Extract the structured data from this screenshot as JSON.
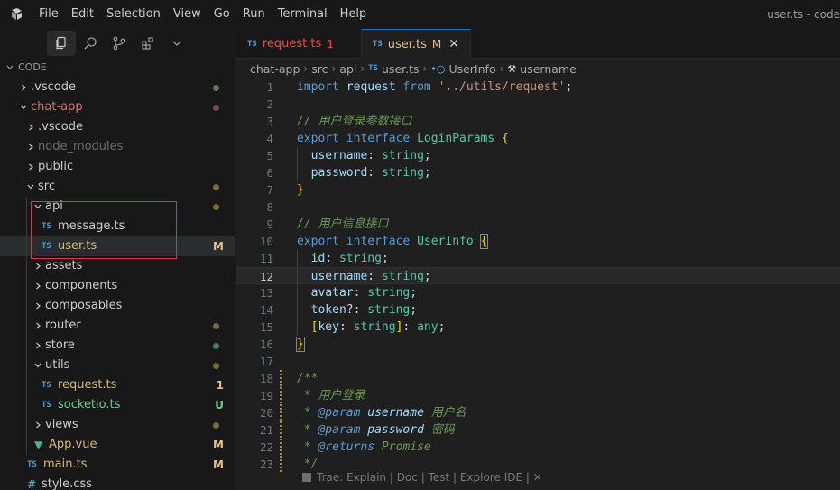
{
  "titlebar": {
    "menu": [
      "File",
      "Edit",
      "Selection",
      "View",
      "Go",
      "Run",
      "Terminal",
      "Help"
    ],
    "window_title": "user.ts - code"
  },
  "sidebar": {
    "toolbar_icons": [
      "explorer-icon",
      "search-icon",
      "source-control-icon",
      "extensions-icon",
      "chevron-down-icon"
    ],
    "section_title": "CODE",
    "tree": [
      {
        "label": ".vscode",
        "depth": 0,
        "kind": "folder",
        "open": false,
        "dot": "#5a7a6a"
      },
      {
        "label": "chat-app",
        "depth": 0,
        "kind": "folder",
        "open": true,
        "color": "red",
        "dot": "#7a4a4a"
      },
      {
        "label": ".vscode",
        "depth": 1,
        "kind": "folder",
        "open": false
      },
      {
        "label": "node_modules",
        "depth": 1,
        "kind": "folder",
        "open": false,
        "color": "dim"
      },
      {
        "label": "public",
        "depth": 1,
        "kind": "folder",
        "open": false
      },
      {
        "label": "src",
        "depth": 1,
        "kind": "folder",
        "open": true,
        "dot": "#7a6a3a"
      },
      {
        "label": "api",
        "depth": 2,
        "kind": "folder",
        "open": true,
        "dot": "#7a6a3a"
      },
      {
        "label": "message.ts",
        "depth": 3,
        "kind": "ts"
      },
      {
        "label": "user.ts",
        "depth": 3,
        "kind": "ts",
        "badge": "M",
        "selected": true
      },
      {
        "label": "assets",
        "depth": 2,
        "kind": "folder",
        "open": false
      },
      {
        "label": "components",
        "depth": 2,
        "kind": "folder",
        "open": false
      },
      {
        "label": "composables",
        "depth": 2,
        "kind": "folder",
        "open": false
      },
      {
        "label": "router",
        "depth": 2,
        "kind": "folder",
        "open": false,
        "dot": "#7a6a3a"
      },
      {
        "label": "store",
        "depth": 2,
        "kind": "folder",
        "open": false,
        "dot": "#4a7a6a"
      },
      {
        "label": "utils",
        "depth": 2,
        "kind": "folder",
        "open": true,
        "dot": "#7a6a3a"
      },
      {
        "label": "request.ts",
        "depth": 3,
        "kind": "ts",
        "badge": "1"
      },
      {
        "label": "socketio.ts",
        "depth": 3,
        "kind": "ts",
        "badge": "U"
      },
      {
        "label": "views",
        "depth": 2,
        "kind": "folder",
        "open": false,
        "dot": "#7a6a3a"
      },
      {
        "label": "App.vue",
        "depth": 2,
        "kind": "vue",
        "badge": "M"
      },
      {
        "label": "main.ts",
        "depth": 1,
        "kind": "ts",
        "badge": "M"
      },
      {
        "label": "style.css",
        "depth": 1,
        "kind": "css"
      }
    ]
  },
  "tabs": [
    {
      "label": "request.ts",
      "status": "1",
      "kind": "err",
      "active": false
    },
    {
      "label": "user.ts",
      "status": "M",
      "kind": "mod",
      "active": true
    }
  ],
  "breadcrumb": [
    "chat-app",
    "src",
    "api",
    "user.ts",
    "UserInfo",
    "username"
  ],
  "code": {
    "current_line": 12,
    "lines": [
      [
        [
          "k",
          "import"
        ],
        [
          "p",
          " "
        ],
        [
          "v",
          "request"
        ],
        [
          "p",
          " "
        ],
        [
          "k",
          "from"
        ],
        [
          "p",
          " "
        ],
        [
          "s",
          "'../utils/request'"
        ],
        [
          "p",
          ";"
        ]
      ],
      [],
      [
        [
          "c",
          "// 用户登录参数接口"
        ]
      ],
      [
        [
          "k",
          "export"
        ],
        [
          "p",
          " "
        ],
        [
          "k",
          "interface"
        ],
        [
          "p",
          " "
        ],
        [
          "t",
          "LoginParams"
        ],
        [
          "p",
          " "
        ],
        [
          "br",
          "{"
        ]
      ],
      [
        [
          "p",
          "  "
        ],
        [
          "v",
          "username"
        ],
        [
          "p",
          ": "
        ],
        [
          "t",
          "string"
        ],
        [
          "p",
          ";"
        ]
      ],
      [
        [
          "p",
          "  "
        ],
        [
          "v",
          "password"
        ],
        [
          "p",
          ": "
        ],
        [
          "t",
          "string"
        ],
        [
          "p",
          ";"
        ]
      ],
      [
        [
          "br",
          "}"
        ]
      ],
      [],
      [
        [
          "c",
          "// 用户信息接口"
        ]
      ],
      [
        [
          "k",
          "export"
        ],
        [
          "p",
          " "
        ],
        [
          "k",
          "interface"
        ],
        [
          "p",
          " "
        ],
        [
          "t",
          "UserInfo"
        ],
        [
          "p",
          " "
        ],
        [
          "brh",
          "{"
        ]
      ],
      [
        [
          "p",
          "  "
        ],
        [
          "v",
          "id"
        ],
        [
          "p",
          ": "
        ],
        [
          "t",
          "string"
        ],
        [
          "p",
          ";"
        ]
      ],
      [
        [
          "p",
          "  "
        ],
        [
          "v",
          "username"
        ],
        [
          "p",
          ": "
        ],
        [
          "t",
          "string"
        ],
        [
          "p",
          ";"
        ]
      ],
      [
        [
          "p",
          "  "
        ],
        [
          "v",
          "avatar"
        ],
        [
          "p",
          ": "
        ],
        [
          "t",
          "string"
        ],
        [
          "p",
          ";"
        ]
      ],
      [
        [
          "p",
          "  "
        ],
        [
          "v",
          "token"
        ],
        [
          "p",
          "?: "
        ],
        [
          "t",
          "string"
        ],
        [
          "p",
          ";"
        ]
      ],
      [
        [
          "p",
          "  "
        ],
        [
          "br",
          "["
        ],
        [
          "v",
          "key"
        ],
        [
          "p",
          ": "
        ],
        [
          "t",
          "string"
        ],
        [
          "br",
          "]"
        ],
        [
          "p",
          ": "
        ],
        [
          "t",
          "any"
        ],
        [
          "p",
          ";"
        ]
      ],
      [
        [
          "brh",
          "}"
        ]
      ],
      [],
      [
        [
          "ci",
          "/**"
        ]
      ],
      [
        [
          "ci",
          " * 用户登录"
        ]
      ],
      [
        [
          "ci",
          " * "
        ],
        [
          "jd",
          "@param"
        ],
        [
          "p",
          " "
        ],
        [
          "jp",
          "username"
        ],
        [
          "ci",
          " 用户名"
        ]
      ],
      [
        [
          "ci",
          " * "
        ],
        [
          "jd",
          "@param"
        ],
        [
          "p",
          " "
        ],
        [
          "jp",
          "password"
        ],
        [
          "ci",
          " 密码"
        ]
      ],
      [
        [
          "ci",
          " * "
        ],
        [
          "jd",
          "@returns"
        ],
        [
          "ci",
          " Promise"
        ]
      ],
      [
        [
          "ci",
          " */"
        ]
      ]
    ],
    "gitbar_lines": [
      18,
      19,
      20,
      21,
      22,
      23
    ],
    "guide_lines": [
      5,
      6,
      11,
      12,
      13,
      14,
      15
    ]
  },
  "inline_hint": "Trae: Explain | Doc | Test | Explore IDE | ✕"
}
